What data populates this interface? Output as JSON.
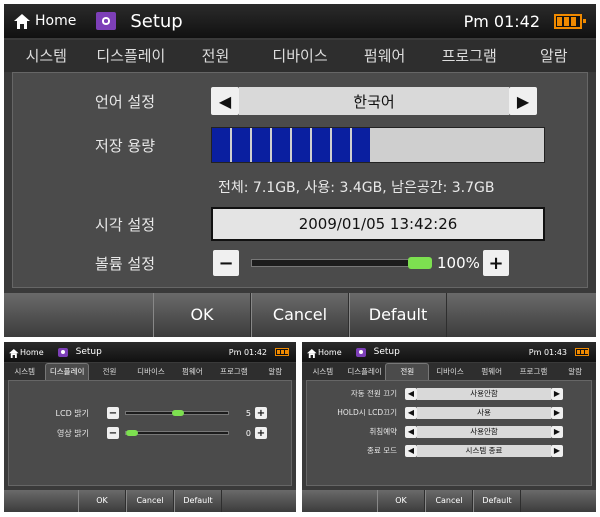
{
  "main": {
    "home_label": "Home",
    "title": "Setup",
    "clock": "Pm 01:42",
    "tabs": [
      "시스템",
      "디스플레이",
      "전원",
      "디바이스",
      "펌웨어",
      "프로그램",
      "알람"
    ],
    "active_tab": "시스템",
    "language": {
      "label": "언어 설정",
      "value": "한국어"
    },
    "storage": {
      "label": "저장 용량",
      "used_fraction": 0.46,
      "summary": "전체: 7.1GB, 사용: 3.4GB, 남은공간: 3.7GB"
    },
    "time": {
      "label": "시각 설정",
      "value": "2009/01/05 13:42:26"
    },
    "volume": {
      "label": "볼륨 설정",
      "value": "100%",
      "level": 1.0
    },
    "buttons": {
      "ok": "OK",
      "cancel": "Cancel",
      "default": "Default"
    }
  },
  "display": {
    "home_label": "Home",
    "title": "Setup",
    "clock": "Pm 01:42",
    "tabs": [
      "시스템",
      "디스플레이",
      "전원",
      "디바이스",
      "펌웨어",
      "프로그램",
      "알람"
    ],
    "active_tab": "디스플레이",
    "lcd": {
      "label": "LCD 밝기",
      "value": "5",
      "level": 0.5
    },
    "video": {
      "label": "영상 밝기",
      "value": "0",
      "level": 0.0
    },
    "buttons": {
      "ok": "OK",
      "cancel": "Cancel",
      "default": "Default"
    }
  },
  "power": {
    "home_label": "Home",
    "title": "Setup",
    "clock": "Pm 01:43",
    "tabs": [
      "시스템",
      "디스플레이",
      "전원",
      "디바이스",
      "펌웨어",
      "프로그램",
      "알람"
    ],
    "active_tab": "전원",
    "rows": [
      {
        "label": "자동 전원 끄기",
        "value": "사용안함"
      },
      {
        "label": "HOLD시 LCD끄기",
        "value": "사용"
      },
      {
        "label": "취침예약",
        "value": "사용안함"
      },
      {
        "label": "종료 모드",
        "value": "시스템 종료"
      }
    ],
    "buttons": {
      "ok": "OK",
      "cancel": "Cancel",
      "default": "Default"
    }
  },
  "colors": {
    "accent_battery": "#f08a00",
    "storage_fill": "#0a1fa0",
    "slider": "#7de050",
    "setup_icon": "#7d3fb8"
  }
}
